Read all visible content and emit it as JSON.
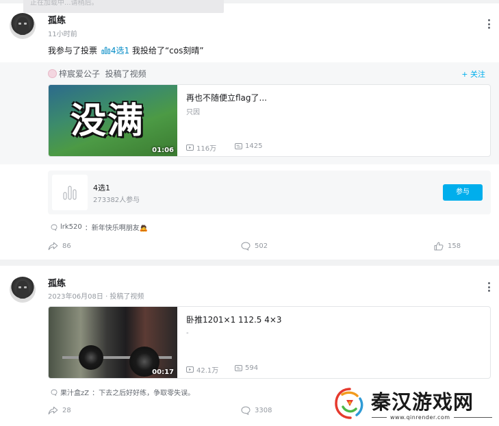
{
  "toast_text": "正在加载中...请稍后。",
  "post1": {
    "username": "孤练",
    "time": "11小时前",
    "text_prefix": "我参与了投票",
    "vote_link": "4选1",
    "text_suffix": " 我投给了“cos刻晴”",
    "repost": {
      "author": "梓宸爱公子",
      "action": "投稿了视频",
      "follow_label": "+ 关注",
      "video": {
        "thumbnail_text": "没满",
        "duration": "01:06",
        "title": "再也不随便立flag了...",
        "subtitle": "只因",
        "plays": "116万",
        "danmaku": "1425"
      }
    },
    "vote": {
      "title": "4选1",
      "participants": "273382人参与",
      "join_label": "参与"
    },
    "comment": {
      "user": "lrk520",
      "text": "：新年快乐啊朋友🙇"
    },
    "shares": "86",
    "comments": "502",
    "likes": "158"
  },
  "post2": {
    "username": "孤练",
    "time": "2023年06月08日 · 投稿了视频",
    "video": {
      "duration": "00:17",
      "title": "卧推1201×1 112.5 4×3",
      "subtitle": "-",
      "plays": "42.1万",
      "danmaku": "594"
    },
    "comment": {
      "user": "果汁盒zZ",
      "text": "：下去之后好好练，争取零失误。"
    },
    "shares": "28",
    "comments": "3308"
  },
  "watermark": {
    "title": "秦汉游戏网",
    "url": "www.qinrender.com"
  },
  "icons": {
    "more": "more-vertical-icon",
    "share": "share-icon",
    "comment": "comment-icon",
    "like": "thumbs-up-icon",
    "play": "play-icon",
    "danmaku": "danmaku-icon",
    "vote": "vote-bars-icon"
  },
  "colors": {
    "accent": "#00aeec",
    "link": "#008ac5",
    "muted": "#9499a0"
  }
}
